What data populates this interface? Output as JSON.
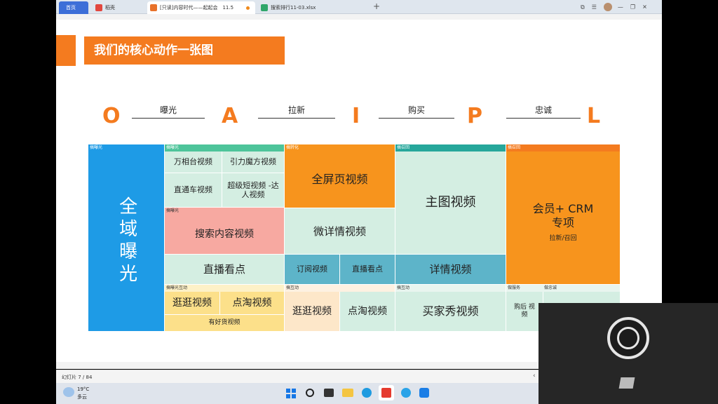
{
  "browser": {
    "tabs": [
      {
        "label": "首页"
      },
      {
        "label": "稻壳"
      },
      {
        "label": "[只读]内容时代——起起会　11.5"
      },
      {
        "label": "搜索排行11-03.xlsx"
      }
    ],
    "new_tab_symbol": "+",
    "window_controls": [
      "⧉",
      "☰",
      "—",
      "❐",
      "✕"
    ]
  },
  "slide": {
    "title": "我们的核心动作一张图",
    "oaipl": {
      "letters": [
        "O",
        "A",
        "I",
        "P",
        "L"
      ],
      "connectors": [
        "曝光",
        "拉新",
        "购买",
        "忠诚"
      ]
    },
    "grid": {
      "col1": {
        "header": "搞曝光",
        "main": "全域曝光"
      },
      "col2": {
        "header1": "搞曝光",
        "a": "万相台视频",
        "b": "引力魔方视频",
        "c": "直通车视频",
        "d": "超级短视频 -达人视频",
        "header2": "搞曝光",
        "e": "搜索内容视频",
        "f": "直播看点",
        "header3": "搞曝光互动",
        "g": "逛逛视频",
        "h": "点淘视频",
        "i": "有好货视频"
      },
      "col3": {
        "header1": "搞转化",
        "a": "全屏页视频",
        "b": "微详情视频",
        "c": "订阅视频",
        "d": "直播看点",
        "header2": "搞互动",
        "e": "逛逛视频",
        "f": "点淘视频"
      },
      "col4": {
        "header1": "搞召回",
        "a": "主图视频",
        "b": "详情视频",
        "header2": "搞互动",
        "c": "买家秀视频"
      },
      "col5": {
        "header1": "搞召回",
        "a": "会员+ CRM专项",
        "a_sub": "拉新/召回",
        "header2a": "做服务",
        "header2b": "做忠诚",
        "b": "购后 视频"
      }
    }
  },
  "status": {
    "slide_counter": "幻灯片 7 / 84"
  },
  "taskbar": {
    "weather_temp": "19°C",
    "weather_desc": "多云"
  },
  "colors": {
    "orange": "#f47b1f",
    "blue": "#1e9be6",
    "teal": "#26a79b",
    "light_green": "#d4eee2"
  }
}
